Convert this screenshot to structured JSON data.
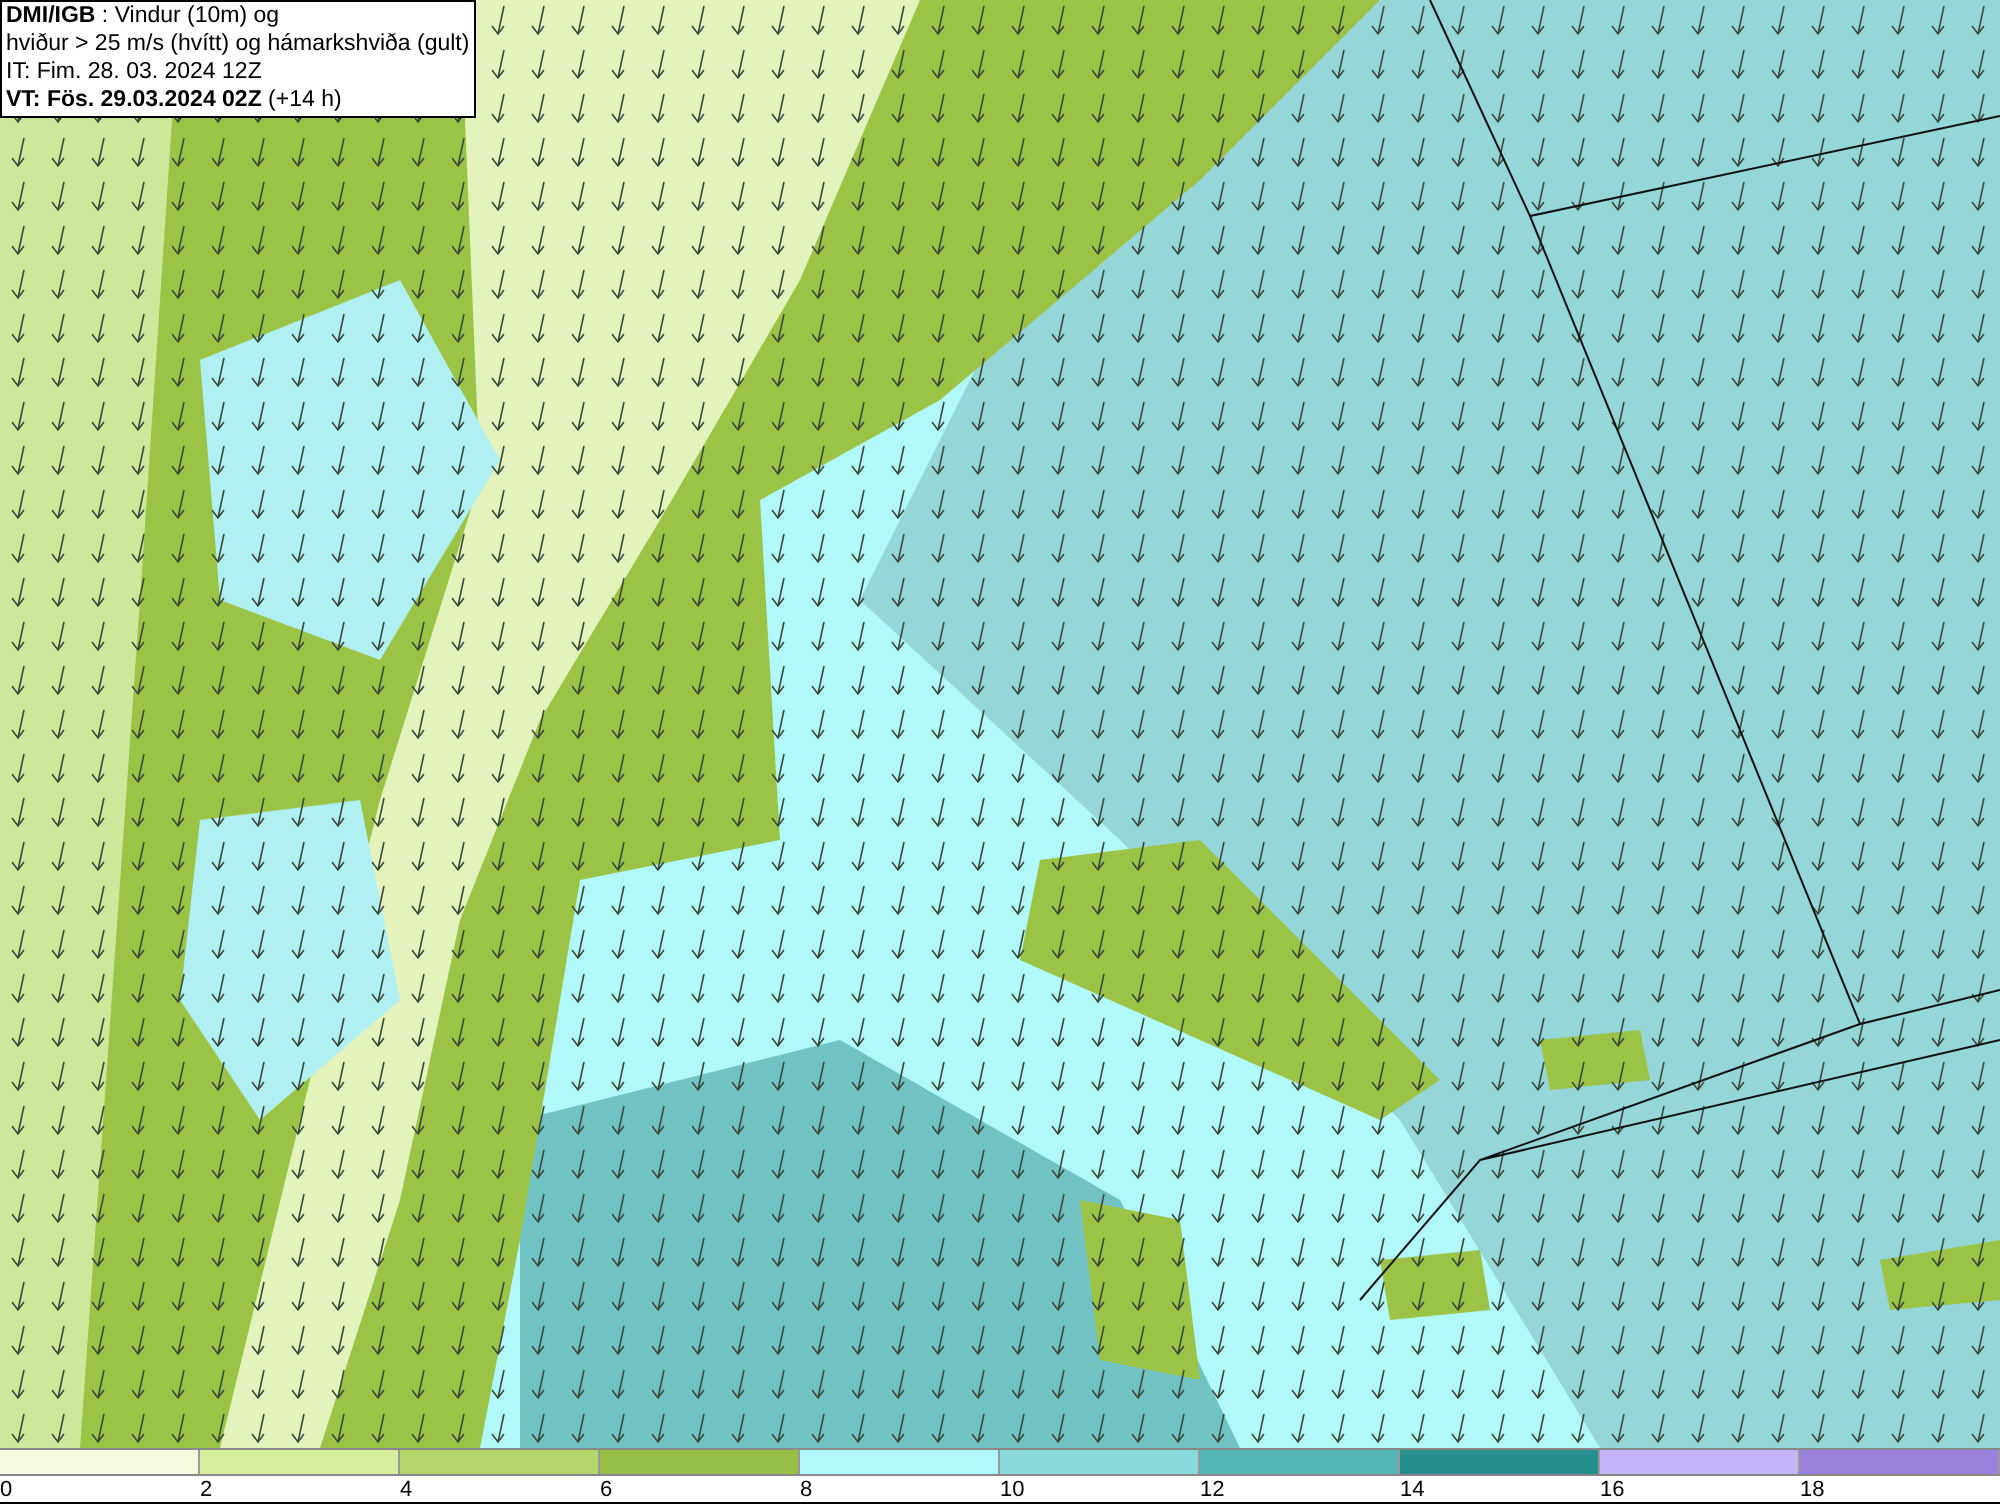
{
  "title_box": {
    "lines": [
      "**DMI/IGB** : Vindur (10m) og",
      "hviður > 25 m/s (hvítt) og hámarkshviða (gult)",
      "IT: Fim. 28. 03. 2024 12Z",
      "**VT: Fös. 29.03.2024 02Z** (+14 h)"
    ]
  },
  "legend": {
    "bins": [
      {
        "label": "0",
        "color": "#f4fadf"
      },
      {
        "label": "2",
        "color": "#d5ed9c"
      },
      {
        "label": "4",
        "color": "#b5d66d"
      },
      {
        "label": "6",
        "color": "#97bf45"
      },
      {
        "label": "8",
        "color": "#aff9fb"
      },
      {
        "label": "10",
        "color": "#88dadb"
      },
      {
        "label": "12",
        "color": "#55b5b5"
      },
      {
        "label": "14",
        "color": "#248f8e"
      },
      {
        "label": "16",
        "color": "#c4b5fa"
      },
      {
        "label": "18",
        "color": "#9a82dc"
      }
    ]
  }
}
